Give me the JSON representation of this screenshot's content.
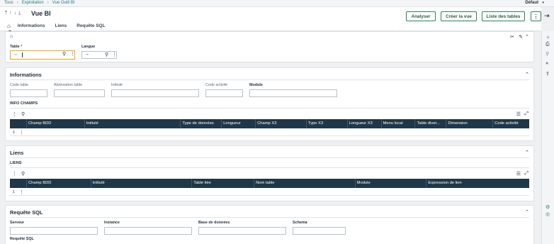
{
  "breadcrumb": [
    "Tous",
    "Exploitation",
    "Vue Outil BI"
  ],
  "user": "Défaut",
  "page_title": "Vue BI",
  "buttons": {
    "analyser": "Analyser",
    "creer": "Créer la vue",
    "liste": "Liste des tables",
    "more": "⋮"
  },
  "tabs": [
    "Informations",
    "Liens",
    "Requête SQL"
  ],
  "filter": {
    "table_label": "Table",
    "table_required": "*",
    "langue_label": "Langue"
  },
  "informations": {
    "title": "Informations",
    "fields": [
      "Code table",
      "Abréviation table",
      "Intitulé",
      "Code activité",
      "Module"
    ],
    "grid_title": "INFO CHAMPS",
    "columns": [
      "Champ BDD",
      "Intitulé",
      "Type de données",
      "Longueur",
      "Champ X3",
      "Type X3",
      "Longueur X3",
      "Menu local",
      "Table diver...",
      "Dimension",
      "Code activité"
    ],
    "row_number": "1"
  },
  "liens": {
    "title": "Liens",
    "grid_title": "LIENS",
    "columns": [
      "Champ BDD",
      "Intitulé",
      "Table liée",
      "Nom table",
      "Module",
      "Expression de lien"
    ],
    "row_number": "1"
  },
  "requete": {
    "title": "Requête SQL",
    "fields": [
      "Serveur",
      "Instance",
      "Base de données",
      "Schema"
    ],
    "sub_label": "Requête SQL"
  },
  "icons": {
    "home": "home-icon",
    "search": "search-icon",
    "kebab": "kebab-icon",
    "chevron": "chevron-up-icon"
  }
}
